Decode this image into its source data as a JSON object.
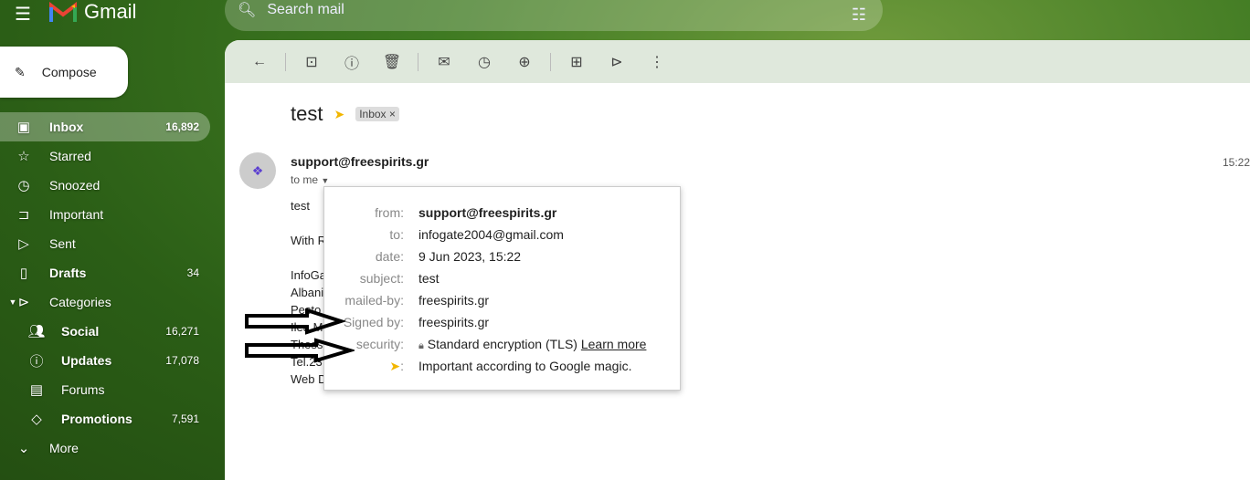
{
  "app": {
    "name": "Gmail",
    "menu_icon": "hamburger-icon"
  },
  "search": {
    "placeholder": "Search mail"
  },
  "compose": {
    "label": "Compose"
  },
  "sidebar": {
    "items": [
      {
        "label": "Inbox",
        "count": "16,892",
        "icon": "inbox-icon"
      },
      {
        "label": "Starred",
        "count": "",
        "icon": "star-icon"
      },
      {
        "label": "Snoozed",
        "count": "",
        "icon": "clock-icon"
      },
      {
        "label": "Important",
        "count": "",
        "icon": "important-icon"
      },
      {
        "label": "Sent",
        "count": "",
        "icon": "send-icon"
      },
      {
        "label": "Drafts",
        "count": "34",
        "icon": "draft-icon"
      },
      {
        "label": "Categories",
        "count": "",
        "icon": "label-icon"
      },
      {
        "label": "Social",
        "count": "16,271",
        "icon": "people-icon"
      },
      {
        "label": "Updates",
        "count": "17,078",
        "icon": "info-icon"
      },
      {
        "label": "Forums",
        "count": "",
        "icon": "forum-icon"
      },
      {
        "label": "Promotions",
        "count": "7,591",
        "icon": "tag-icon"
      },
      {
        "label": "More",
        "count": "",
        "icon": "chevron-down-icon"
      }
    ]
  },
  "email": {
    "subject": "test",
    "label_chip": "Inbox",
    "sender": "support@freespirits.gr",
    "time": "15:22",
    "recipient_summary": "to me",
    "body": [
      "test",
      "",
      "With R",
      "",
      "InfoGa",
      "Albani",
      "Pesto",
      "Ilea M",
      "Thess",
      "Tel.23",
      "Web D"
    ]
  },
  "details": {
    "from_label": "from:",
    "from": "support@freespirits.gr",
    "to_label": "to:",
    "to": "infogate2004@gmail.com",
    "date_label": "date:",
    "date": "9 Jun 2023, 15:22",
    "subject_label": "subject:",
    "subject": "test",
    "mailedby_label": "mailed-by:",
    "mailedby": "freespirits.gr",
    "signedby_label": "Signed by:",
    "signedby": "freespirits.gr",
    "security_label": "security:",
    "security": "Standard encryption (TLS)",
    "learn_more": "Learn more",
    "importance_label": ":",
    "importance": "Important according to Google magic."
  }
}
